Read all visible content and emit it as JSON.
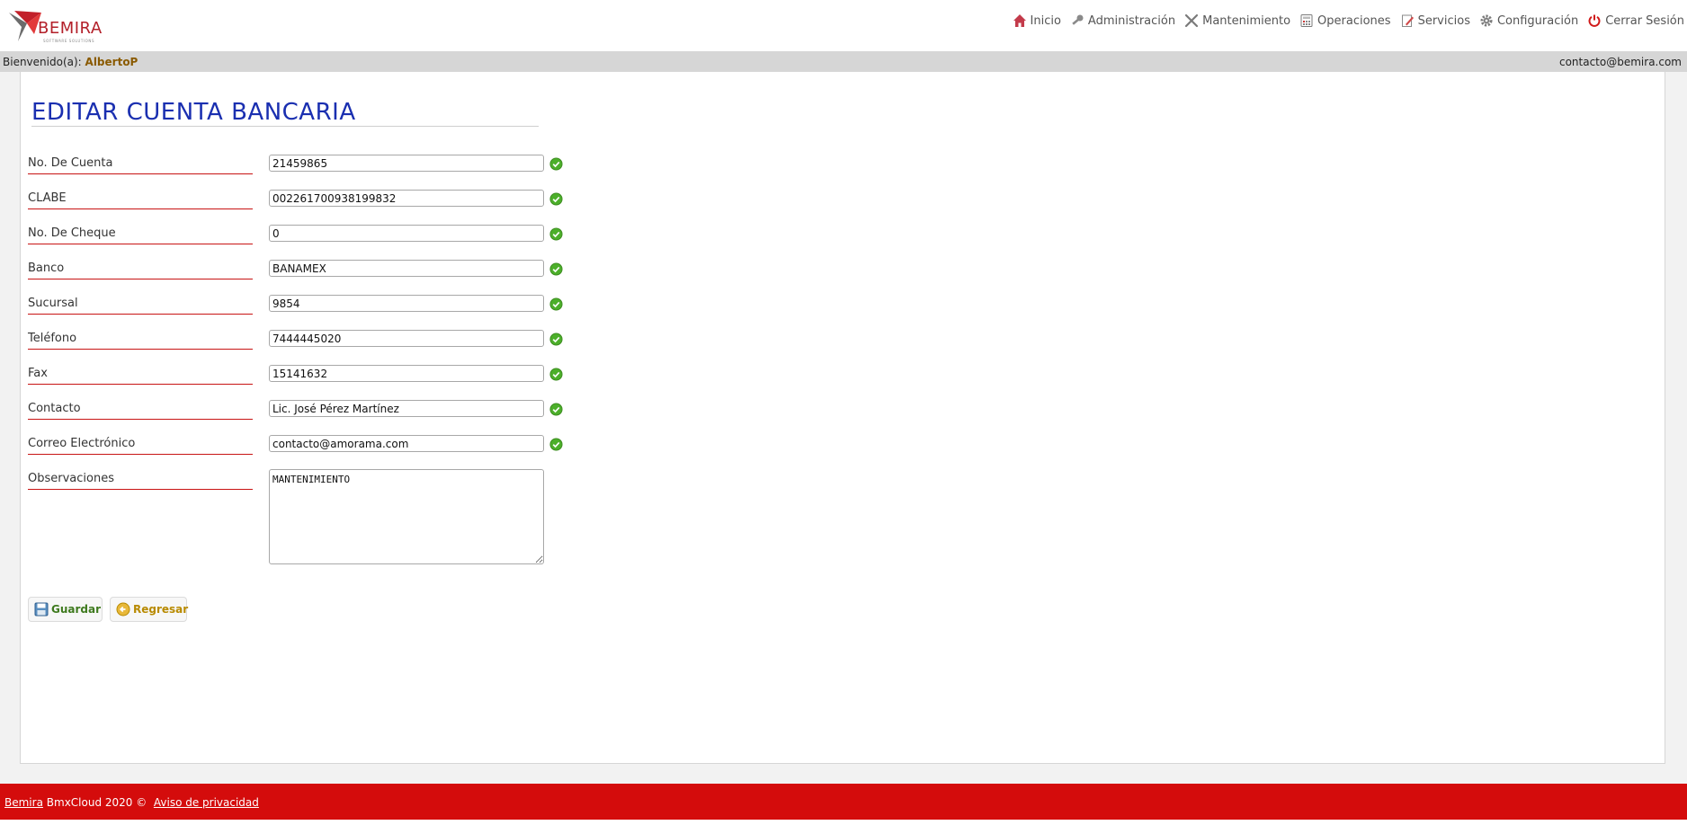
{
  "app": {
    "brand": "BEMIRA",
    "tagline": "SOFTWARE SOLUTIONS"
  },
  "nav": {
    "items": [
      {
        "label": "Inicio",
        "icon": "home-icon"
      },
      {
        "label": "Administración",
        "icon": "key-icon"
      },
      {
        "label": "Mantenimiento",
        "icon": "tools-icon"
      },
      {
        "label": "Operaciones",
        "icon": "calculator-icon"
      },
      {
        "label": "Servicios",
        "icon": "edit-icon"
      },
      {
        "label": "Configuración",
        "icon": "gear-icon"
      },
      {
        "label": "Cerrar Sesión",
        "icon": "power-icon"
      }
    ]
  },
  "welcome": {
    "prefix": "Bienvenido(a):",
    "user": "AlbertoP",
    "email": "contacto@bemira.com"
  },
  "form": {
    "title": "EDITAR CUENTA BANCARIA",
    "fields": [
      {
        "label": "No. De Cuenta",
        "value": "21459865"
      },
      {
        "label": "CLABE",
        "value": "002261700938199832"
      },
      {
        "label": "No. De Cheque",
        "value": "0"
      },
      {
        "label": "Banco",
        "value": "BANAMEX"
      },
      {
        "label": "Sucursal",
        "value": "9854"
      },
      {
        "label": "Teléfono",
        "value": "7444445020"
      },
      {
        "label": "Fax",
        "value": "15141632"
      },
      {
        "label": "Contacto",
        "value": "Lic. José Pérez Martínez"
      },
      {
        "label": "Correo Electrónico",
        "value": "contacto@amorama.com"
      }
    ],
    "observaciones": {
      "label": "Observaciones",
      "value": "MANTENIMIENTO"
    },
    "buttons": {
      "save": "Guardar",
      "back": "Regresar"
    }
  },
  "footer": {
    "brand_link": "Bemira",
    "text": "BmxCloud 2020 ©",
    "privacy_link": "Aviso de privacidad"
  },
  "colors": {
    "title": "#1a2fb0",
    "label_underline": "#c81414",
    "footer": "#d40c0c",
    "ok": "#4caf2a"
  }
}
